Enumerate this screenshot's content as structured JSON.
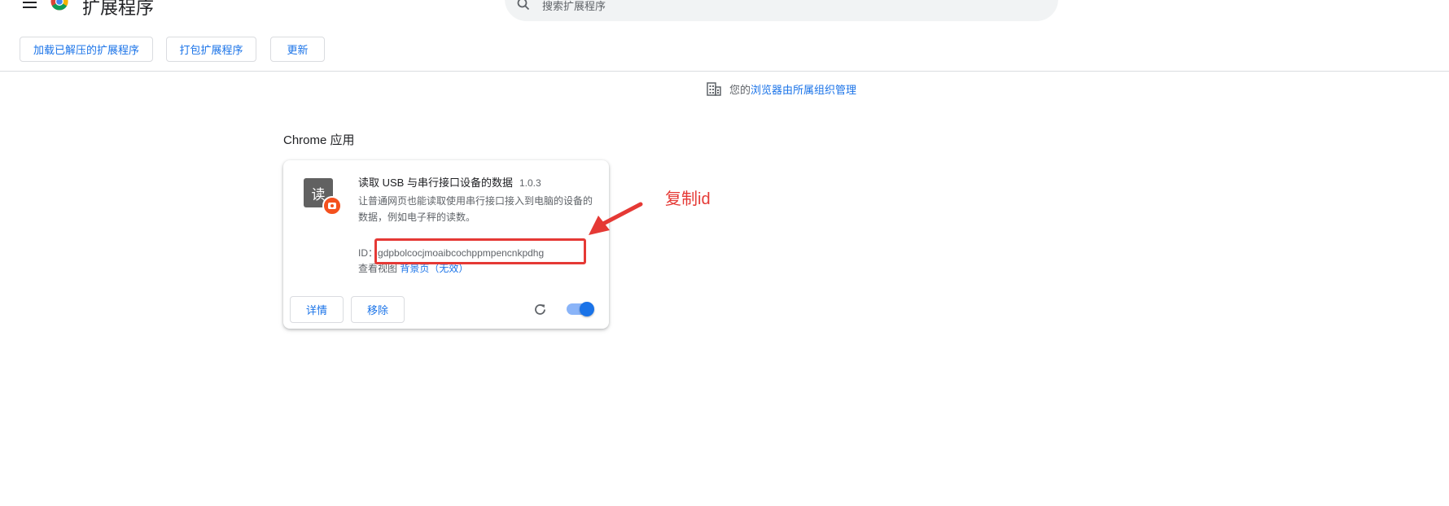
{
  "header": {
    "title": "扩展程序",
    "search_placeholder": "搜索扩展程序"
  },
  "toolbar": {
    "load_unpacked": "加载已解压的扩展程序",
    "pack_extension": "打包扩展程序",
    "update": "更新"
  },
  "managed_notice": {
    "prefix": "您的",
    "link": "浏览器由所属组织管理"
  },
  "section": {
    "title": "Chrome 应用"
  },
  "extension": {
    "icon_char": "读",
    "name": "读取 USB 与串行接口设备的数据",
    "version": "1.0.3",
    "description": "让普通网页也能读取使用串行接口接入到电脑的设备的数据，例如电子秤的读数。",
    "id_label": "ID：",
    "id_value": "gdpbolcocjmoaibcochppmpencnkpdhg",
    "inspect_label": "查看视图",
    "inspect_link": "背景页（无效）",
    "details_button": "详情",
    "remove_button": "移除",
    "enabled": true
  },
  "annotation": {
    "text": "复制id",
    "color": "#e53935"
  },
  "colors": {
    "accent": "#1a73e8",
    "annotation": "#e53935"
  }
}
